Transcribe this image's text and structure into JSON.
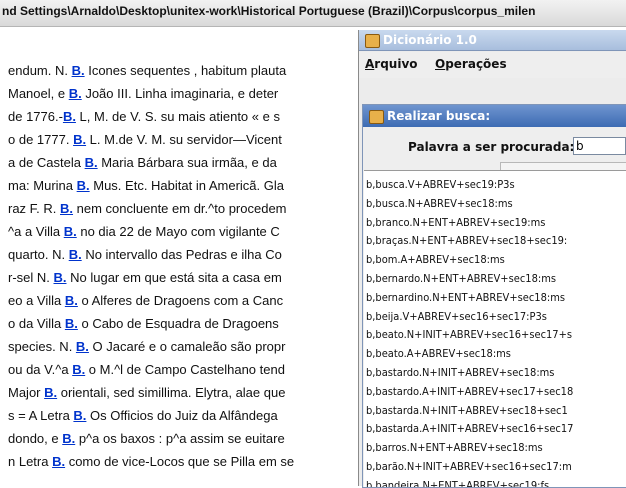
{
  "path_title": "nd Settings\\Arnaldo\\Desktop\\unitex-work\\Historical Portuguese (Brazil)\\Corpus\\corpus_milen",
  "doc_lines": [
    {
      "before": "endum. N. ",
      "hl": "B.",
      "after": " Icones sequentes , habitum plauta"
    },
    {
      "before": " Manoel, e ",
      "hl": "B.",
      "after": " João III. Linha imaginaria, e deter"
    },
    {
      "before": "de 1776.-",
      "hl": "B.",
      "after": " L, M. de V. S. su mais atiento « e s"
    },
    {
      "before": "o de 1777. ",
      "hl": "B.",
      "after": " L. M.de V. M. su servidor—Vicent"
    },
    {
      "before": "a de Castela ",
      "hl": "B.",
      "after": " Maria Bárbara sua irmãa, e da"
    },
    {
      "before": "ma: Murina ",
      "hl": "B.",
      "after": " Mus. Etc. Habitat in Americã. Gla"
    },
    {
      "before": "raz F. R. ",
      "hl": "B.",
      "after": " nem concluente em dr.^to procedem"
    },
    {
      "before": " ^a a Villa ",
      "hl": "B.",
      "after": " no dia 22 de Mayo com vigilante C"
    },
    {
      "before": " quarto. N. ",
      "hl": "B.",
      "after": " No intervallo das Pedras e ilha Co"
    },
    {
      "before": "r-sel N. ",
      "hl": "B.",
      "after": " No lugar em que está sita a casa em"
    },
    {
      "before": "eo a Villa ",
      "hl": "B.",
      "after": " o Alferes de Dragoens com a Canc"
    },
    {
      "before": "o da Villa ",
      "hl": "B.",
      "after": " o Cabo de Esquadra de Dragoens"
    },
    {
      "before": "species. N. ",
      "hl": "B.",
      "after": " O Jacaré e o camaleão são propr"
    },
    {
      "before": "ou da V.^a ",
      "hl": "B.",
      "after": " o M.^l de Campo Castelhano tend"
    },
    {
      "before": " Major ",
      "hl": "B.",
      "after": " orientali, sed simillima. Elytra, alae que"
    },
    {
      "before": "s = A Letra ",
      "hl": "B.",
      "after": " Os Officios do Juiz da Alfândega"
    },
    {
      "before": "dondo, e ",
      "hl": "B.",
      "after": " p^a os baxos : p^a assim se euitare"
    },
    {
      "before": "n Letra ",
      "hl": "B.",
      "after": " como de vice-Locos que se Pilla em se"
    }
  ],
  "dictionary_window": {
    "title": "Dicionário 1.0",
    "menu": [
      {
        "label": "Arquivo",
        "mnemonic": "A",
        "rest": "rquivo"
      },
      {
        "label": "Operações",
        "mnemonic": "O",
        "rest": "perações"
      }
    ]
  },
  "search_dialog": {
    "title": "Realizar busca:",
    "label": "Palavra a ser procurada:",
    "input_value": "b"
  },
  "results": [
    "b,busca.V+ABREV+sec19:P3s",
    "b,busca.N+ABREV+sec18:ms",
    "b,branco.N+ENT+ABREV+sec19:ms",
    "b,braças.N+ENT+ABREV+sec18+sec19:",
    "b,bom.A+ABREV+sec18:ms",
    "b,bernardo.N+ENT+ABREV+sec18:ms",
    "b,bernardino.N+ENT+ABREV+sec18:ms",
    "b,beija.V+ABREV+sec16+sec17:P3s",
    "b,beato.N+INIT+ABREV+sec16+sec17+s",
    "b,beato.A+ABREV+sec18:ms",
    "b,bastardo.N+INIT+ABREV+sec18:ms",
    "b,bastardo.A+INIT+ABREV+sec17+sec18",
    "b,bastarda.N+INIT+ABREV+sec18+sec1",
    "b,bastarda.A+INIT+ABREV+sec16+sec17",
    "b,barros.N+ENT+ABREV+sec18:ms",
    "b,barão.N+INIT+ABREV+sec16+sec17:m",
    "b,bandeira.N+ENT+ABREV+sec19:fs"
  ]
}
